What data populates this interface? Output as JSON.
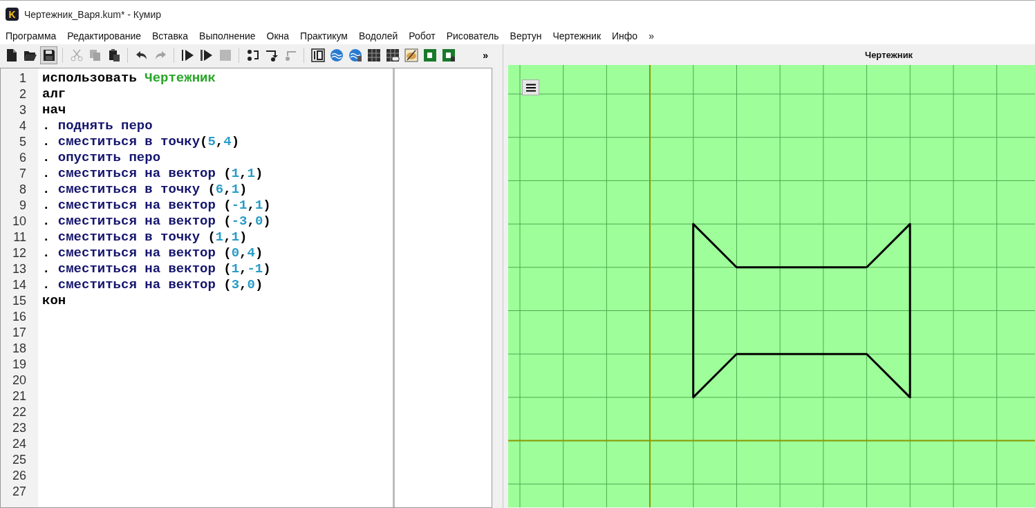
{
  "window": {
    "title": "Чертежник_Варя.kum* - Кумир",
    "app_icon": "K"
  },
  "menu": {
    "items": [
      "Программа",
      "Редактирование",
      "Вставка",
      "Выполнение",
      "Окна",
      "Практикум",
      "Водолей",
      "Робот",
      "Рисователь",
      "Вертун",
      "Чертежник",
      "Инфо"
    ],
    "overflow": "»"
  },
  "toolbar": {
    "overflow": "»",
    "groups": [
      [
        {
          "kind": "new",
          "disabled": false,
          "pressed": false
        },
        {
          "kind": "open",
          "disabled": false,
          "pressed": false
        },
        {
          "kind": "save",
          "disabled": false,
          "pressed": true
        }
      ],
      [
        {
          "kind": "cut",
          "disabled": true,
          "pressed": false
        },
        {
          "kind": "copy",
          "disabled": true,
          "pressed": false
        },
        {
          "kind": "paste",
          "disabled": false,
          "pressed": false
        }
      ],
      [
        {
          "kind": "undo",
          "disabled": false,
          "pressed": false
        },
        {
          "kind": "redo",
          "disabled": true,
          "pressed": false
        }
      ],
      [
        {
          "kind": "run",
          "disabled": false,
          "pressed": false
        },
        {
          "kind": "run-step",
          "disabled": false,
          "pressed": false
        },
        {
          "kind": "stop",
          "disabled": true,
          "pressed": false
        }
      ],
      [
        {
          "kind": "step-over",
          "disabled": false,
          "pressed": false
        },
        {
          "kind": "step-in",
          "disabled": false,
          "pressed": false
        },
        {
          "kind": "step-out",
          "disabled": true,
          "pressed": false
        }
      ],
      [
        {
          "kind": "counter",
          "disabled": false,
          "pressed": false
        },
        {
          "kind": "waves",
          "disabled": false,
          "pressed": false
        },
        {
          "kind": "waves-table",
          "disabled": false,
          "pressed": false
        },
        {
          "kind": "grid",
          "disabled": false,
          "pressed": false
        },
        {
          "kind": "grid-pad",
          "disabled": false,
          "pressed": false
        },
        {
          "kind": "palette",
          "disabled": false,
          "pressed": false
        },
        {
          "kind": "tile",
          "disabled": false,
          "pressed": false
        },
        {
          "kind": "tile-table",
          "disabled": false,
          "pressed": false
        }
      ]
    ]
  },
  "editor": {
    "lines": [
      {
        "number": "1",
        "tokens": [
          {
            "kind": "kw",
            "text": "использовать "
          },
          {
            "kind": "module",
            "text": "Чертежник"
          }
        ]
      },
      {
        "number": "2",
        "tokens": [
          {
            "kind": "kw",
            "text": "алг"
          }
        ]
      },
      {
        "number": "3",
        "tokens": [
          {
            "kind": "kw",
            "text": "нач"
          }
        ]
      },
      {
        "number": "4",
        "tokens": [
          {
            "kind": "indent",
            "text": "."
          },
          {
            "kind": "cmd",
            "text": " поднять перо"
          }
        ]
      },
      {
        "number": "5",
        "tokens": [
          {
            "kind": "indent",
            "text": "."
          },
          {
            "kind": "cmd",
            "text": " сместиться в точку"
          },
          {
            "kind": "punct",
            "text": "("
          },
          {
            "kind": "num",
            "text": "5"
          },
          {
            "kind": "punct",
            "text": ","
          },
          {
            "kind": "num",
            "text": "4"
          },
          {
            "kind": "punct",
            "text": ")"
          }
        ]
      },
      {
        "number": "6",
        "tokens": [
          {
            "kind": "indent",
            "text": "."
          },
          {
            "kind": "cmd",
            "text": " опустить перо"
          }
        ]
      },
      {
        "number": "7",
        "tokens": [
          {
            "kind": "indent",
            "text": "."
          },
          {
            "kind": "cmd",
            "text": " сместиться на вектор "
          },
          {
            "kind": "punct",
            "text": "("
          },
          {
            "kind": "num",
            "text": "1"
          },
          {
            "kind": "punct",
            "text": ","
          },
          {
            "kind": "num",
            "text": "1"
          },
          {
            "kind": "punct",
            "text": ")"
          }
        ]
      },
      {
        "number": "8",
        "tokens": [
          {
            "kind": "indent",
            "text": "."
          },
          {
            "kind": "cmd",
            "text": " сместиться в точку "
          },
          {
            "kind": "punct",
            "text": "("
          },
          {
            "kind": "num",
            "text": "6"
          },
          {
            "kind": "punct",
            "text": ","
          },
          {
            "kind": "num",
            "text": "1"
          },
          {
            "kind": "punct",
            "text": ")"
          }
        ]
      },
      {
        "number": "9",
        "tokens": [
          {
            "kind": "indent",
            "text": "."
          },
          {
            "kind": "cmd",
            "text": " сместиться на вектор "
          },
          {
            "kind": "punct",
            "text": "("
          },
          {
            "kind": "num",
            "text": "-1"
          },
          {
            "kind": "punct",
            "text": ","
          },
          {
            "kind": "num",
            "text": "1"
          },
          {
            "kind": "punct",
            "text": ")"
          }
        ]
      },
      {
        "number": "10",
        "tokens": [
          {
            "kind": "indent",
            "text": "."
          },
          {
            "kind": "cmd",
            "text": " сместиться на вектор "
          },
          {
            "kind": "punct",
            "text": "("
          },
          {
            "kind": "num",
            "text": "-3"
          },
          {
            "kind": "punct",
            "text": ","
          },
          {
            "kind": "num",
            "text": "0"
          },
          {
            "kind": "punct",
            "text": ")"
          }
        ]
      },
      {
        "number": "11",
        "tokens": [
          {
            "kind": "indent",
            "text": "."
          },
          {
            "kind": "cmd",
            "text": " сместиться в точку "
          },
          {
            "kind": "punct",
            "text": "("
          },
          {
            "kind": "num",
            "text": "1"
          },
          {
            "kind": "punct",
            "text": ","
          },
          {
            "kind": "num",
            "text": "1"
          },
          {
            "kind": "punct",
            "text": ")"
          }
        ]
      },
      {
        "number": "12",
        "tokens": [
          {
            "kind": "indent",
            "text": "."
          },
          {
            "kind": "cmd",
            "text": " сместиться на вектор "
          },
          {
            "kind": "punct",
            "text": "("
          },
          {
            "kind": "num",
            "text": "0"
          },
          {
            "kind": "punct",
            "text": ","
          },
          {
            "kind": "num",
            "text": "4"
          },
          {
            "kind": "punct",
            "text": ")"
          }
        ]
      },
      {
        "number": "13",
        "tokens": [
          {
            "kind": "indent",
            "text": "."
          },
          {
            "kind": "cmd",
            "text": " сместиться на вектор "
          },
          {
            "kind": "punct",
            "text": "("
          },
          {
            "kind": "num",
            "text": "1"
          },
          {
            "kind": "punct",
            "text": ","
          },
          {
            "kind": "num",
            "text": "-1"
          },
          {
            "kind": "punct",
            "text": ")"
          }
        ]
      },
      {
        "number": "14",
        "tokens": [
          {
            "kind": "indent",
            "text": "."
          },
          {
            "kind": "cmd",
            "text": " сместиться на вектор "
          },
          {
            "kind": "punct",
            "text": "("
          },
          {
            "kind": "num",
            "text": "3"
          },
          {
            "kind": "punct",
            "text": ","
          },
          {
            "kind": "num",
            "text": "0"
          },
          {
            "kind": "punct",
            "text": ")"
          }
        ]
      },
      {
        "number": "15",
        "tokens": [
          {
            "kind": "kw",
            "text": "кон"
          }
        ]
      },
      {
        "number": "16"
      },
      {
        "number": "17"
      },
      {
        "number": "18"
      },
      {
        "number": "19"
      },
      {
        "number": "20"
      },
      {
        "number": "21"
      },
      {
        "number": "22"
      },
      {
        "number": "23"
      },
      {
        "number": "24"
      },
      {
        "number": "25"
      },
      {
        "number": "26"
      },
      {
        "number": "27"
      }
    ]
  },
  "drawer_panel": {
    "title": "Чертежник"
  }
}
